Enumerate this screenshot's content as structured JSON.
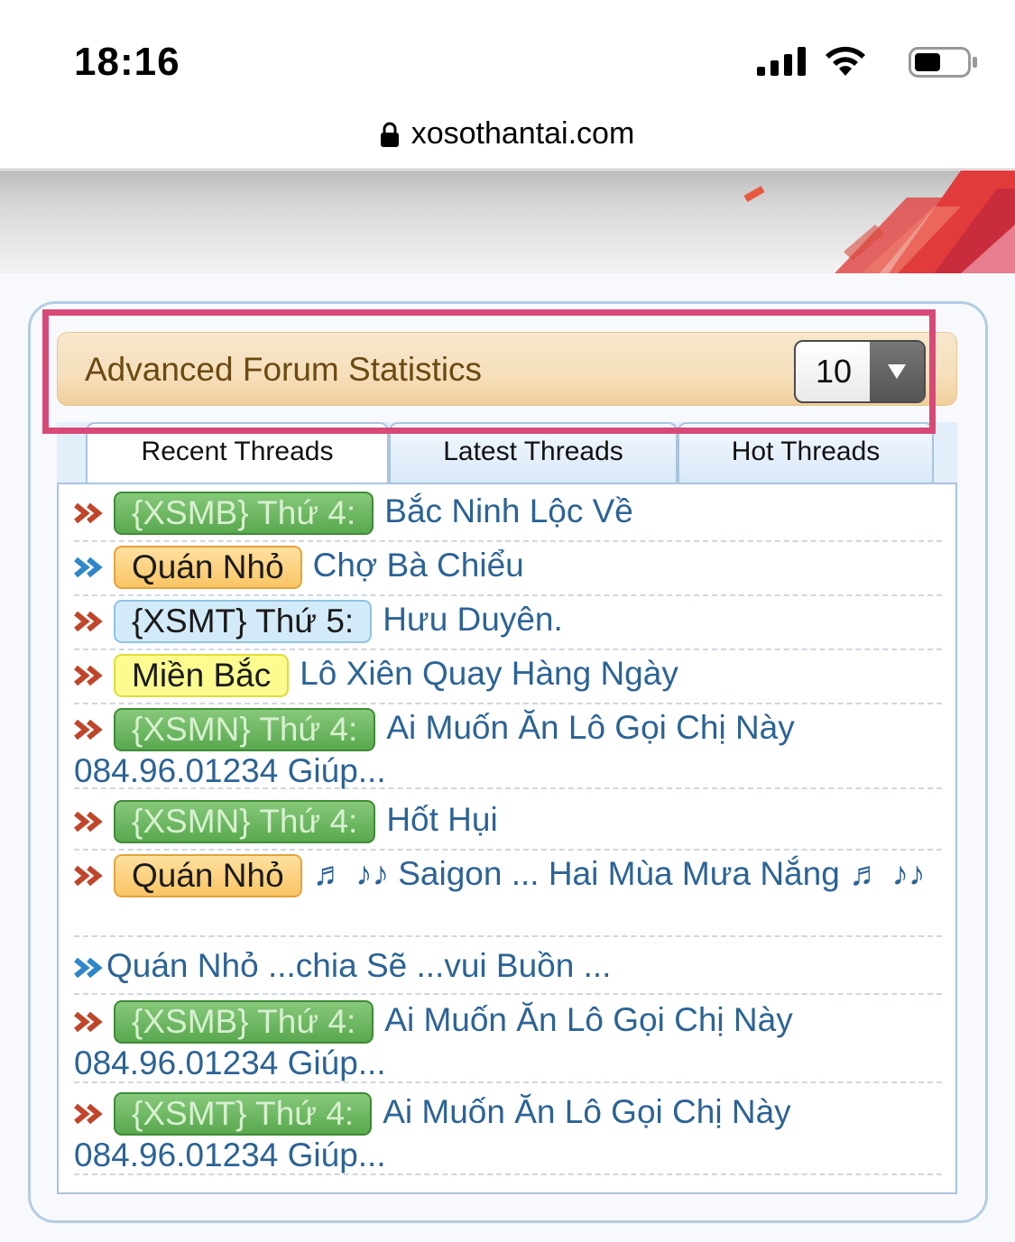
{
  "status_bar": {
    "time": "18:16",
    "signal_icon": "cellular-signal-icon",
    "wifi_icon": "wifi-icon",
    "battery_icon": "battery-icon"
  },
  "browser": {
    "url": "xosothantai.com",
    "lock_icon": "lock-icon"
  },
  "stats": {
    "title": "Advanced Forum Statistics",
    "count_selected": "10",
    "tabs": [
      {
        "label": "Recent Threads",
        "active": true
      },
      {
        "label": "Latest Threads",
        "active": false
      },
      {
        "label": "Hot Threads",
        "active": false
      }
    ],
    "threads": [
      {
        "arrow": "red",
        "prefix": "{XSMB} Thứ 4:",
        "prefix_style": "green",
        "title": "Bắc Ninh Lộc Về"
      },
      {
        "arrow": "blue",
        "prefix": "Quán Nhỏ",
        "prefix_style": "orange",
        "title": "Chợ Bà Chiểu"
      },
      {
        "arrow": "red",
        "prefix": "{XSMT} Thứ 5:",
        "prefix_style": "blue",
        "title": "Hưu Duyên."
      },
      {
        "arrow": "red",
        "prefix": "Miền Bắc",
        "prefix_style": "yellow",
        "title": "Lô Xiên Quay Hàng Ngày"
      },
      {
        "arrow": "red",
        "prefix": "{XSMN} Thứ 4:",
        "prefix_style": "green",
        "title": "Ai Muốn Ăn Lô Gọi Chị Này 084.96.01234 Giúp..."
      },
      {
        "arrow": "red",
        "prefix": "{XSMN} Thứ 4:",
        "prefix_style": "green",
        "title": "Hốt Hụi"
      },
      {
        "arrow": "red",
        "prefix": "Quán Nhỏ",
        "prefix_style": "orange",
        "title": "♬ ♪♪ Saigon ... Hai Mùa Mưa Nắng ♬ ♪♪"
      },
      {
        "arrow": "blue",
        "prefix": "",
        "prefix_style": "",
        "title": "Quán Nhỏ ...chia Sẽ ...vui Buồn ..."
      },
      {
        "arrow": "red",
        "prefix": "{XSMB} Thứ 4:",
        "prefix_style": "green",
        "title": "Ai Muốn Ăn Lô Gọi Chị Này 084.96.01234 Giúp..."
      },
      {
        "arrow": "red",
        "prefix": "{XSMT} Thứ 4:",
        "prefix_style": "green",
        "title": "Ai Muốn Ăn Lô Gọi Chị Này 084.96.01234 Giúp..."
      }
    ]
  },
  "colors": {
    "highlight": "#d74a78",
    "link": "#2c6395",
    "header_text": "#6b4a12",
    "arrow_red": "#c0452a",
    "arrow_blue": "#2f86c9"
  }
}
